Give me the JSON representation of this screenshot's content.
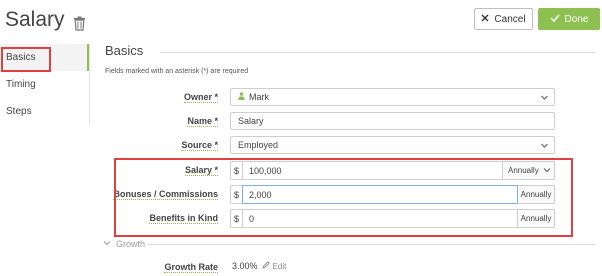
{
  "header": {
    "title": "Salary",
    "cancel_label": "Cancel",
    "done_label": "Done"
  },
  "sidebar": {
    "items": [
      {
        "label": "Basics",
        "active": true
      },
      {
        "label": "Timing",
        "active": false
      },
      {
        "label": "Steps",
        "active": false
      }
    ]
  },
  "section": {
    "title": "Basics",
    "required_note": "Fields marked with an asterisk (*) are required"
  },
  "form": {
    "owner": {
      "label": "Owner *",
      "value": "Mark"
    },
    "name": {
      "label": "Name *",
      "value": "Salary"
    },
    "source": {
      "label": "Source *",
      "value": "Employed"
    },
    "salary": {
      "label": "Salary *",
      "currency": "$",
      "value": "100,000",
      "frequency": "Annually"
    },
    "bonuses": {
      "label": "Bonuses / Commissions",
      "currency": "$",
      "value": "2,000",
      "frequency": "Annually"
    },
    "benefits": {
      "label": "Benefits in Kind",
      "currency": "$",
      "value": "0",
      "frequency": "Annually"
    }
  },
  "growth": {
    "toggle_label": "Growth",
    "rate_label": "Growth Rate",
    "rate_value": "3.00%",
    "edit_label": "Edit"
  },
  "colors": {
    "accent_green": "#8cc152",
    "highlight_red": "#e04040"
  }
}
